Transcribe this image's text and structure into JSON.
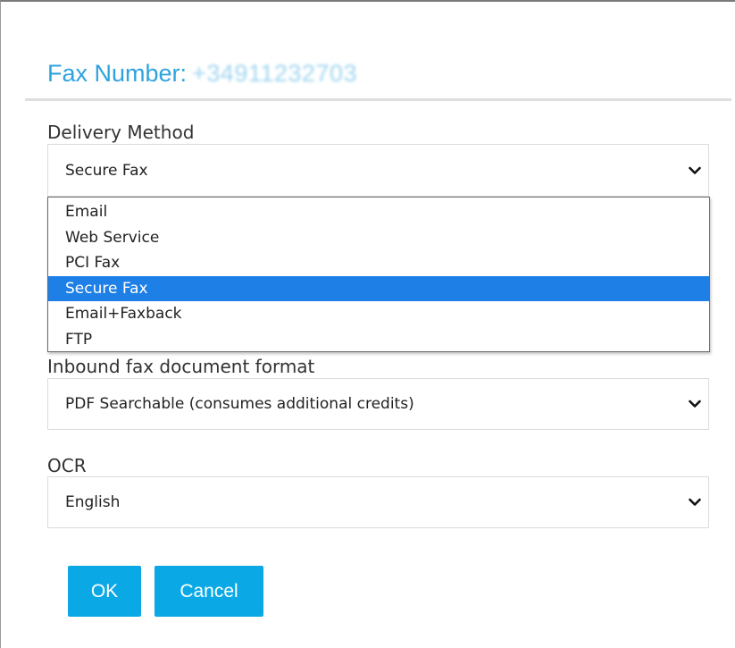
{
  "dialog": {
    "title_label": "Fax Number:",
    "title_value": "+34911232703"
  },
  "delivery": {
    "label": "Delivery Method",
    "selected": "Secure Fax",
    "options": [
      "Email",
      "Web Service",
      "PCI Fax",
      "Secure Fax",
      "Email+Faxback",
      "FTP"
    ],
    "highlighted_index": 3
  },
  "inbound": {
    "label": "Inbound fax document format",
    "selected": "PDF Searchable (consumes additional credits)"
  },
  "ocr": {
    "label": "OCR",
    "selected": "English"
  },
  "buttons": {
    "ok": "OK",
    "cancel": "Cancel"
  },
  "colors": {
    "accent": "#2ea3de",
    "button": "#0aa9e6",
    "option_highlight": "#1e7fe6"
  },
  "icons": {
    "select_arrow": "chevron-down-icon"
  }
}
